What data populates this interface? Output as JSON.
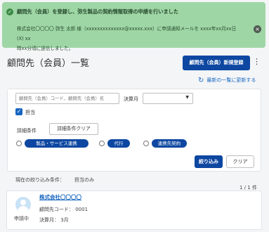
{
  "toast": {
    "title": "顧問先（会員）を登録し、弥生製品の契約情報取得の申請を行いました",
    "line1": "株式会社〇〇〇〇 弥生 太郎 様（xxxxxxxxxxxxxx@xxxxx.xxx）に申請通知メールを xxxx年xx月xx日(X) xx",
    "line2": "時xx分頃に送信しました。",
    "check_icon": "check-circle-icon",
    "close_icon": "close-circle-icon"
  },
  "header": {
    "title": "顧問先（会員）一覧",
    "new_button": "顧問先（会員）新規登録",
    "more_icon": "kebab-menu-icon",
    "refresh_label": "最新の一覧に更新する",
    "refresh_icon": "refresh-icon"
  },
  "filter": {
    "search_placeholder": "顧問先（会員）コード、顧問先（会員）名",
    "month_label": "決算月",
    "month_value": "",
    "tanto_label": "担当",
    "tanto_checked": true,
    "detail_label": "詳細条件",
    "detail_clear_button": "詳細条件クリア",
    "tags": [
      "製品・サービス連携",
      "代行",
      "連携先契約"
    ],
    "narrow_button": "絞り込み",
    "clear_button": "クリア"
  },
  "summary": {
    "current_label": "現在の絞り込み条件：",
    "current_value": "担当のみ",
    "count": "1 / 1 件"
  },
  "results": [
    {
      "company": "株式会社〇〇〇〇",
      "code_line": "顧問先コード： 0001",
      "month_line": "決算月： 3月",
      "status": "申請中"
    }
  ],
  "colors": {
    "primary": "#0d47a1",
    "link": "#1565c0",
    "toast_bg": "#9fd6a6"
  }
}
